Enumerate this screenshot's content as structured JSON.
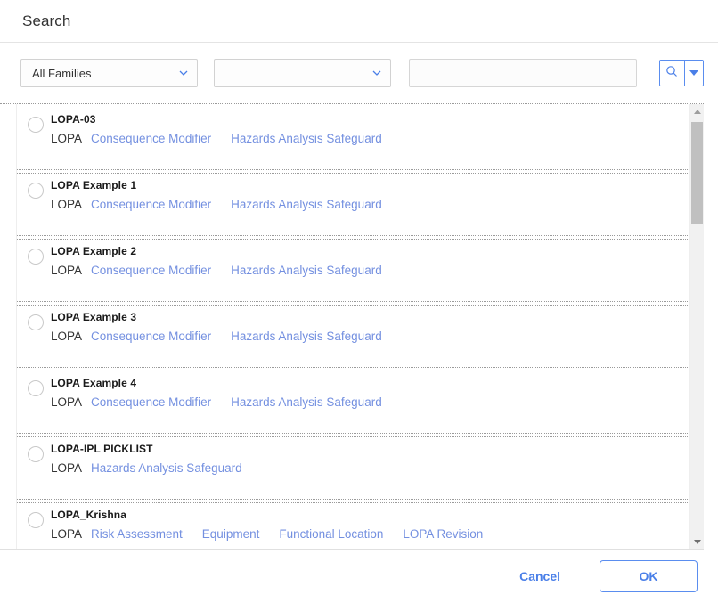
{
  "header": {
    "title": "Search"
  },
  "filters": {
    "family_select": {
      "value": "All Families",
      "icon": "chevron-down-icon"
    },
    "secondary_select": {
      "value": "",
      "icon": "chevron-down-icon"
    },
    "search_input": {
      "value": "",
      "placeholder": ""
    },
    "search_button": {
      "icon": "search-icon"
    },
    "search_dropdown_button": {
      "icon": "caret-down-icon"
    }
  },
  "results": [
    {
      "title": "LOPA-03",
      "family": "LOPA",
      "links": [
        "Consequence Modifier",
        "Hazards Analysis Safeguard"
      ],
      "selected": false
    },
    {
      "title": "LOPA Example 1",
      "family": "LOPA",
      "links": [
        "Consequence Modifier",
        "Hazards Analysis Safeguard"
      ],
      "selected": false
    },
    {
      "title": "LOPA Example 2",
      "family": "LOPA",
      "links": [
        "Consequence Modifier",
        "Hazards Analysis Safeguard"
      ],
      "selected": false
    },
    {
      "title": "LOPA Example 3",
      "family": "LOPA",
      "links": [
        "Consequence Modifier",
        "Hazards Analysis Safeguard"
      ],
      "selected": false
    },
    {
      "title": "LOPA Example 4",
      "family": "LOPA",
      "links": [
        "Consequence Modifier",
        "Hazards Analysis Safeguard"
      ],
      "selected": false
    },
    {
      "title": "LOPA-IPL PICKLIST",
      "family": "LOPA",
      "links": [
        "Hazards Analysis Safeguard"
      ],
      "selected": false
    },
    {
      "title": "LOPA_Krishna",
      "family": "LOPA",
      "links": [
        "Risk Assessment",
        "Equipment",
        "Functional Location",
        "LOPA Revision"
      ],
      "selected": false
    }
  ],
  "scrollbar": {
    "up_icon": "triangle-up-icon",
    "down_icon": "triangle-down-icon",
    "thumb_top_pct": 4,
    "thumb_height_pct": 23
  },
  "footer": {
    "cancel_label": "Cancel",
    "ok_label": "OK"
  },
  "colors": {
    "link": "#7490e0",
    "accent": "#4a7fe8",
    "border": "#d2d2d2",
    "text": "#333333"
  }
}
